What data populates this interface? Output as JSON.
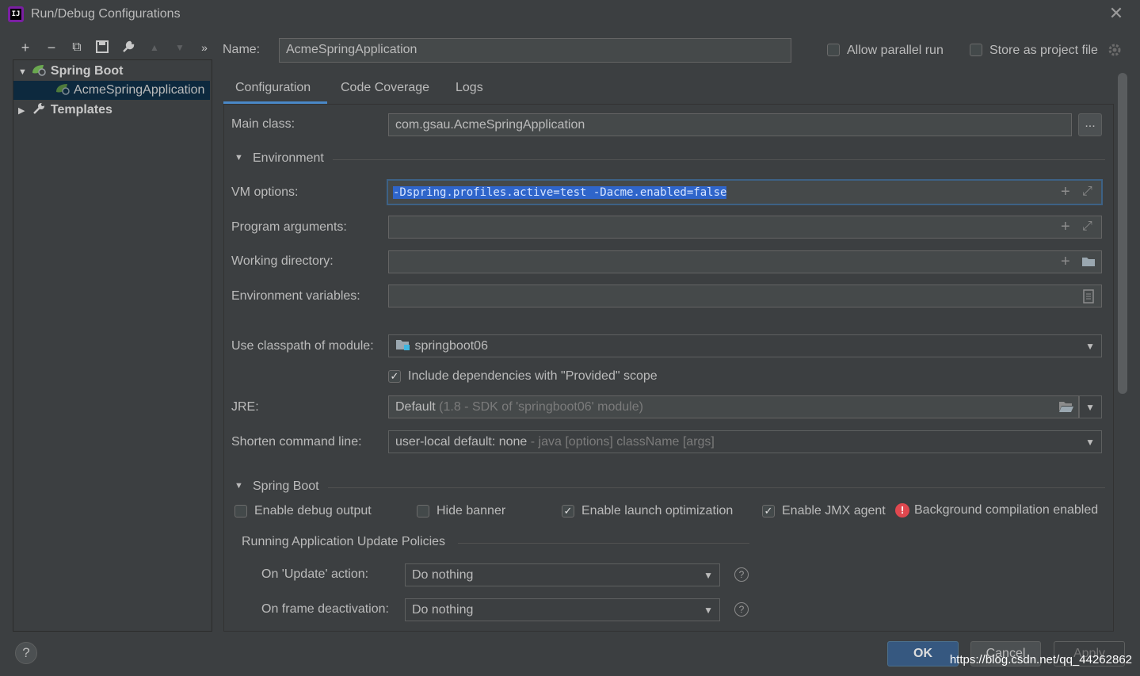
{
  "window": {
    "title": "Run/Debug Configurations"
  },
  "toolbar": {
    "add": "+",
    "remove": "−",
    "copy": "⧉",
    "save": "🖫",
    "edit": "🔧",
    "up": "▲",
    "down": "▼",
    "more": "»"
  },
  "tree": {
    "spring_boot": "Spring Boot",
    "acme_app": "AcmeSpringApplication",
    "templates": "Templates"
  },
  "name": {
    "label": "Name:",
    "value": "AcmeSpringApplication"
  },
  "options": {
    "allow_parallel": "Allow parallel run",
    "store_project": "Store as project file"
  },
  "tabs": [
    "Configuration",
    "Code Coverage",
    "Logs"
  ],
  "main_class": {
    "label": "Main class:",
    "value": "com.gsau.AcmeSpringApplication",
    "browse": "..."
  },
  "environment": {
    "section": "Environment"
  },
  "vm_options": {
    "label": "VM options:",
    "value": "-Dspring.profiles.active=test -Dacme.enabled=false"
  },
  "program_arguments": {
    "label": "Program arguments:"
  },
  "working_directory": {
    "label": "Working directory:"
  },
  "environment_variables": {
    "label": "Environment variables:"
  },
  "classpath": {
    "label": "Use classpath of module:",
    "value": "springboot06"
  },
  "include_provided": {
    "label": "Include dependencies with \"Provided\" scope",
    "checked": true
  },
  "jre": {
    "label": "JRE:",
    "value": "Default",
    "hint": "(1.8 - SDK of 'springboot06' module)"
  },
  "shorten": {
    "label": "Shorten command line:",
    "value": "user-local default: none",
    "hint": "- java [options] className [args]"
  },
  "spring_boot": {
    "section": "Spring Boot",
    "debug_output": "Enable debug output",
    "hide_banner": "Hide banner",
    "launch_optimization": "Enable launch optimization",
    "jmx_agent": "Enable JMX agent",
    "background_compilation": "Background compilation enabled"
  },
  "update_policies": {
    "title": "Running Application Update Policies",
    "on_update_label": "On 'Update' action:",
    "on_update_value": "Do nothing",
    "on_frame_label": "On frame deactivation:",
    "on_frame_value": "Do nothing"
  },
  "buttons": {
    "ok": "OK",
    "cancel": "Cancel",
    "apply": "Apply",
    "help": "?"
  },
  "watermark": "https://blog.csdn.net/qq_44262862",
  "colors": {
    "background": "#3c3f41",
    "accent": "#4a88c7",
    "selection": "#0d293e",
    "ok_button": "#365880",
    "error": "#e0484f"
  }
}
